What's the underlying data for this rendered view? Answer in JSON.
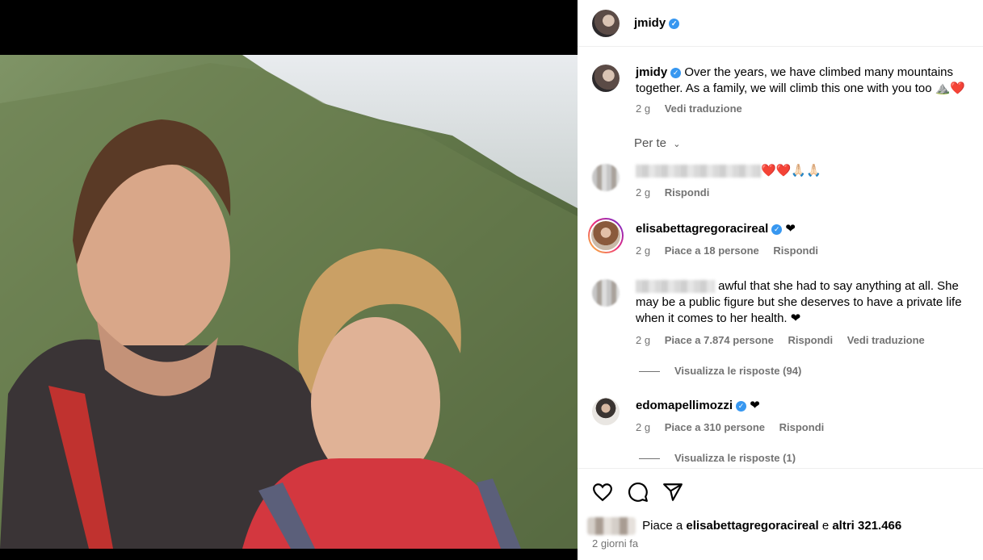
{
  "post": {
    "username": "jmidy",
    "caption": "Over the years, we have climbed many mountains together. As a family, we will climb this one with you too ⛰️❤️",
    "caption_time": "2 g",
    "caption_translate": "Vedi traduzione",
    "filter_label": "Per te"
  },
  "comments": [
    {
      "username": "",
      "text": "❤️❤️🙏🏻🙏🏻",
      "time": "2 g",
      "reply": "Rispondi"
    },
    {
      "username": "elisabettagregoracireal",
      "text": "❤",
      "time": "2 g",
      "likes": "Piace a 18 persone",
      "reply": "Rispondi"
    },
    {
      "username": "",
      "text": "awful that she had to say anything at all. She may be a public figure but she deserves to have a private life when it comes to her health. ❤",
      "time": "2 g",
      "likes": "Piace a 7.874 persone",
      "reply": "Rispondi",
      "translate": "Vedi traduzione",
      "view_replies": "Visualizza le risposte (94)"
    },
    {
      "username": "edomapellimozzi",
      "text": "❤",
      "time": "2 g",
      "likes": "Piace a 310 persone",
      "reply": "Rispondi",
      "view_replies": "Visualizza le risposte (1)"
    }
  ],
  "footer": {
    "likes_prefix": "Piace a",
    "likes_user": "elisabettagregoracireal",
    "likes_mid": "e",
    "likes_others": "altri 321.466",
    "date": "2 giorni fa"
  },
  "icons": [
    "heart-icon",
    "comment-icon",
    "share-icon",
    "verified-icon",
    "chevron-down-icon"
  ],
  "colors": {
    "verified": "#3797f0",
    "muted": "#737373",
    "divider": "#efefef"
  }
}
